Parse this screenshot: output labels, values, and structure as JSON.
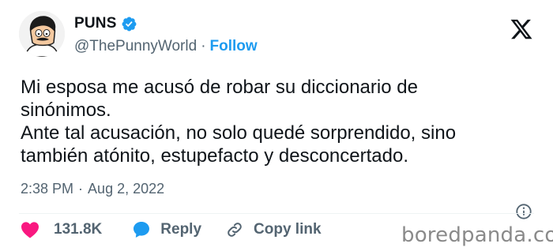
{
  "author": {
    "display_name": "PUNS",
    "handle": "@ThePunnyWorld",
    "separator": "·",
    "follow_label": "Follow",
    "verified_color": "#1d9bf0",
    "avatar_icon": "cartoon-man-avatar-icon"
  },
  "tweet": {
    "lines": [
      "Mi esposa me acusó de robar su diccionario de",
      "sinónimos.",
      "Ante tal acusación, no solo quedé sorprendido, sino",
      "también atónito, estupefacto y desconcertado."
    ]
  },
  "meta": {
    "time": "2:38 PM",
    "separator": "·",
    "date": "Aug 2, 2022"
  },
  "actions": {
    "likes": "131.8K",
    "reply_label": "Reply",
    "copy_link_label": "Copy link",
    "like_color": "#f91880",
    "reply_color": "#1d9bf0"
  },
  "watermark": "boredpanda.com",
  "brand_icon": "x-logo-icon",
  "colors": {
    "text": "#0f1419",
    "secondary": "#536471",
    "accent": "#1d9bf0"
  }
}
